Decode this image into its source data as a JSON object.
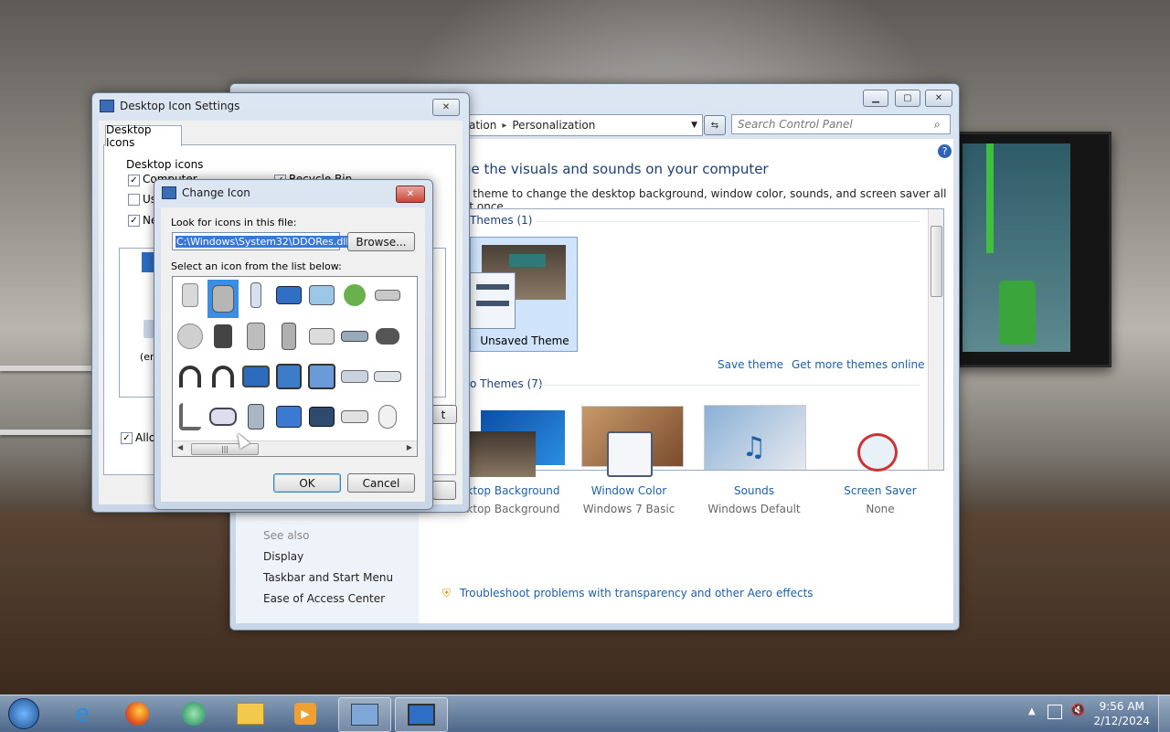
{
  "control_panel": {
    "address": {
      "crumb1": "ation",
      "sep": "▸",
      "crumb2": "Personalization"
    },
    "search_placeholder": "Search Control Panel",
    "heading": "ge the visuals and sounds on your computer",
    "subtext": "n theme to change the desktop background, window color, sounds, and screen saver all at once.",
    "my_themes": "Themes (1)",
    "unsaved_theme": "Unsaved Theme",
    "save_theme": "Save theme",
    "get_more": "Get more themes online",
    "aero_themes": "o Themes (7)",
    "see_also": "See also",
    "left_links": [
      "Display",
      "Taskbar and Start Menu",
      "Ease of Access Center"
    ],
    "bottom": [
      {
        "title": "Desktop Background",
        "sub": "Desktop Background"
      },
      {
        "title": "Window Color",
        "sub": "Windows 7 Basic"
      },
      {
        "title": "Sounds",
        "sub": "Windows Default"
      },
      {
        "title": "Screen Saver",
        "sub": "None"
      }
    ],
    "troubleshoot": "Troubleshoot problems with transparency and other Aero effects"
  },
  "desktop_icon_settings": {
    "title": "Desktop Icon Settings",
    "tab": "Desktop Icons",
    "group": "Desktop icons",
    "items": [
      "Computer",
      "Recycle Bin",
      "Us",
      "Ne"
    ],
    "trash_label": "(em",
    "allow": "Allow",
    "side_button": "t"
  },
  "change_icon": {
    "title": "Change Icon",
    "look_label": "Look for icons in this file:",
    "path": "C:\\Windows\\System32\\DDORes.dll",
    "browse": "Browse...",
    "select_label": "Select an icon from the list below:",
    "ok": "OK",
    "cancel": "Cancel"
  },
  "taskbar": {
    "time": "9:56 AM",
    "date": "2/12/2024"
  }
}
